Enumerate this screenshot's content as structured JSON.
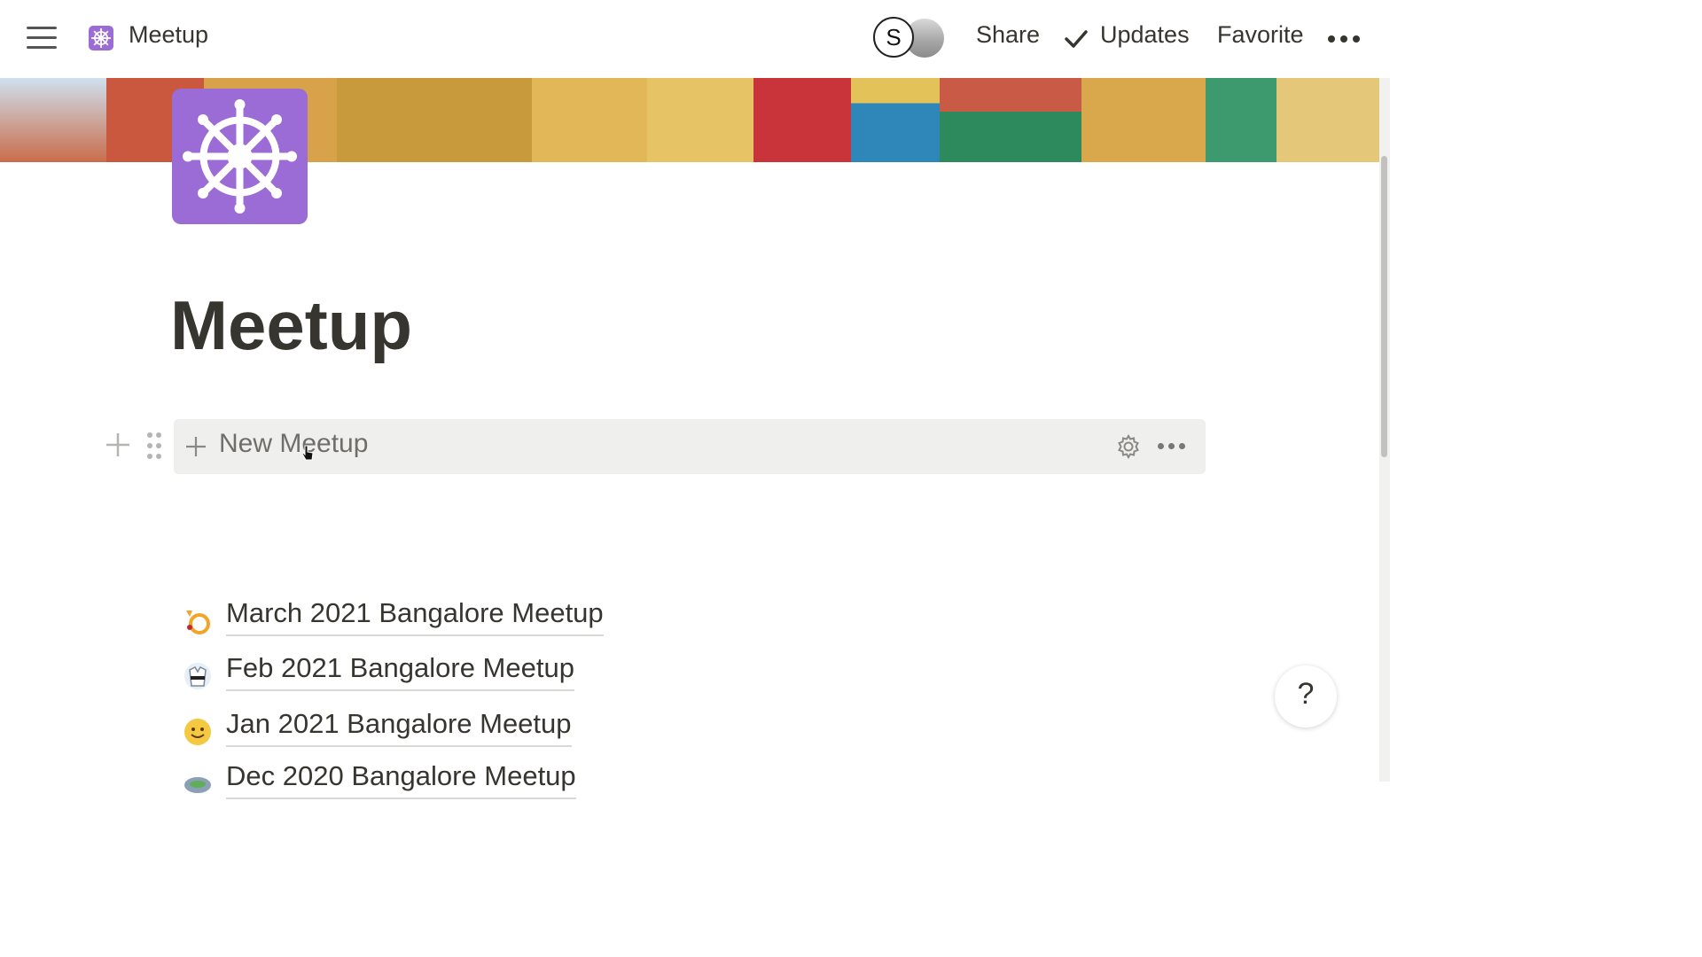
{
  "topbar": {
    "breadcrumb_title": "Meetup",
    "avatar_initial": "S",
    "share_label": "Share",
    "updates_label": "Updates",
    "favorite_label": "Favorite"
  },
  "page": {
    "title": "Meetup",
    "accent_color": "#9b6cd6"
  },
  "database": {
    "new_label": "New Meetup"
  },
  "items": [
    {
      "icon": "trophy-emoji",
      "label": "March 2021 Bangalore Meetup"
    },
    {
      "icon": "martial-arts-uniform-emoji",
      "label": "Feb 2021 Bangalore Meetup"
    },
    {
      "icon": "smiling-face-emoji",
      "label": "Jan 2021 Bangalore Meetup"
    },
    {
      "icon": "stadium-emoji",
      "label": "Dec 2020 Bangalore Meetup"
    }
  ],
  "help": {
    "label": "?"
  }
}
